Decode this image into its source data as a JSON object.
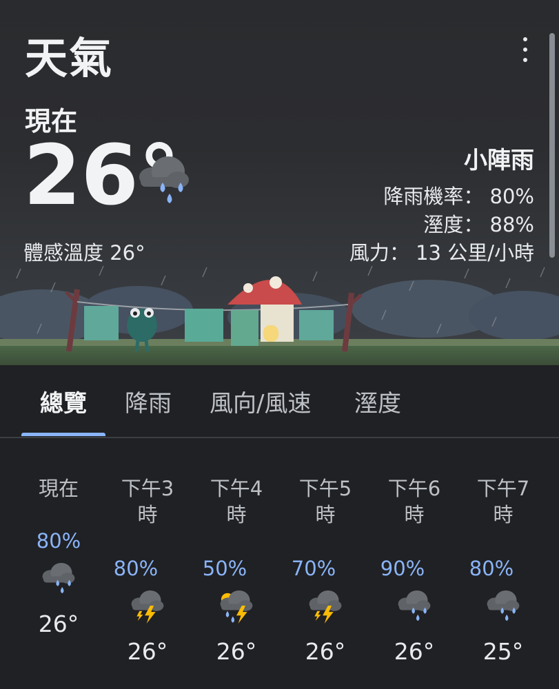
{
  "app": {
    "title": "天氣"
  },
  "current": {
    "label": "現在",
    "temperature": "26°",
    "feels_like": "體感溫度 26°",
    "condition": "小陣雨",
    "precip": "降雨機率： 80%",
    "humidity": "溼度： 88%",
    "wind": "風力： 13 公里/小時",
    "icon": "rain-cloud-icon"
  },
  "tabs": [
    {
      "label": "總覽",
      "active": true
    },
    {
      "label": "降雨",
      "active": false
    },
    {
      "label": "風向/風速",
      "active": false
    },
    {
      "label": "溼度",
      "active": false
    }
  ],
  "hourly": [
    {
      "time": "現在",
      "time2": "",
      "precip": "80%",
      "temp": "26°",
      "icon": "rain-cloud-icon"
    },
    {
      "time": "下午3",
      "time2": "時",
      "precip": "80%",
      "temp": "26°",
      "icon": "thunderstorm-icon"
    },
    {
      "time": "下午4",
      "time2": "時",
      "precip": "50%",
      "temp": "26°",
      "icon": "thunder-rain-icon"
    },
    {
      "time": "下午5",
      "time2": "時",
      "precip": "70%",
      "temp": "26°",
      "icon": "thunderstorm-icon"
    },
    {
      "time": "下午6",
      "time2": "時",
      "precip": "90%",
      "temp": "26°",
      "icon": "rain-cloud-icon"
    },
    {
      "time": "下午7",
      "time2": "時",
      "precip": "80%",
      "temp": "25°",
      "icon": "rain-cloud-icon"
    }
  ],
  "colors": {
    "accent": "#8ab4f8",
    "background": "#202124",
    "bolt": "#fbbc04",
    "cloud": "#5f6368"
  }
}
